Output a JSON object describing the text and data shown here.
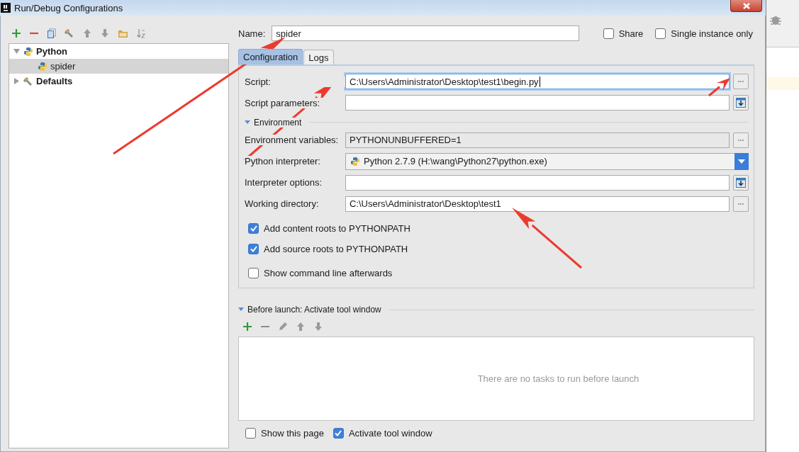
{
  "window": {
    "title": "Run/Debug Configurations"
  },
  "tree": [
    {
      "label": "Python",
      "expanded": true,
      "selected": false,
      "children": [
        {
          "label": "spider",
          "selected": true
        }
      ]
    },
    {
      "label": "Defaults",
      "expanded": false,
      "selected": false
    }
  ],
  "name": {
    "label": "Name:",
    "value": "spider"
  },
  "options": [
    {
      "label": "Share",
      "checked": false
    },
    {
      "label": "Single instance only",
      "checked": false
    }
  ],
  "tabs": [
    {
      "label": "Configuration",
      "selected": true
    },
    {
      "label": "Logs",
      "selected": false
    }
  ],
  "script_fields": [
    {
      "label": "Script:",
      "value": "C:\\Users\\Administrator\\Desktop\\test1\\begin.py",
      "kind": "browse",
      "focused": true
    },
    {
      "label": "Script parameters:",
      "kind": "expand",
      "focused": false
    }
  ],
  "environment": {
    "label": "Environment",
    "expanded": true
  },
  "environment_fields": [
    {
      "label": "Environment variables:",
      "value": "PYTHONUNBUFFERED=1",
      "kind": "readonly",
      "focused": false
    },
    {
      "label": "Python interpreter:",
      "value": "Python 2.7.9 (H:\\wang\\Python27\\python.exe)",
      "kind": "dropdown",
      "focused": false
    },
    {
      "label": "Interpreter options:",
      "kind": "expand",
      "focused": false
    },
    {
      "label": "Working directory:",
      "value": "C:\\Users\\Administrator\\Desktop\\test1",
      "kind": "browse",
      "focused": false
    }
  ],
  "path_options": [
    {
      "label": "Add content roots to PYTHONPATH",
      "checked": true
    },
    {
      "label": "Add source roots to PYTHONPATH",
      "checked": true
    },
    {
      "label": "Show command line afterwards",
      "checked": false
    }
  ],
  "before_launch": {
    "title": "Before launch: Activate tool window",
    "expanded": true,
    "empty_text": "There are no tasks to run before launch"
  },
  "bottom_options": [
    {
      "label": "Show this page",
      "checked": false
    },
    {
      "label": "Activate tool window",
      "checked": true
    }
  ]
}
